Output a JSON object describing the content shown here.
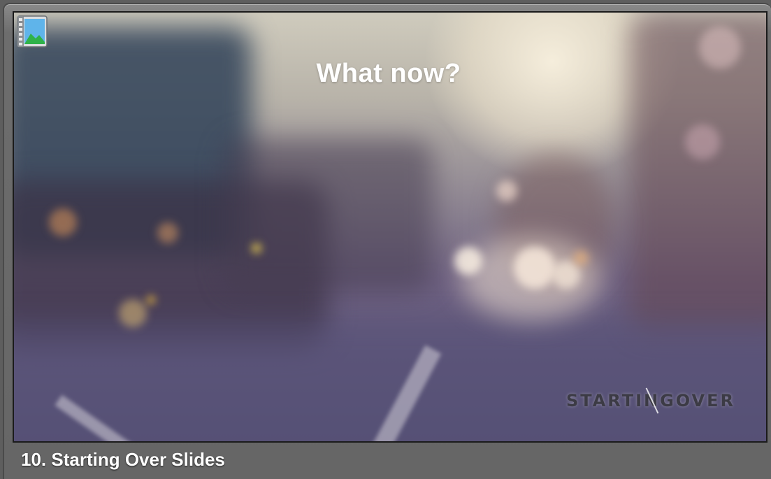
{
  "slide": {
    "headline": "What now?",
    "logo_text": "STARTINGOVER",
    "background_image": "blurred city street at dusk"
  },
  "caption": "10. Starting Over Slides",
  "icons": {
    "media_type": "image-media-icon"
  },
  "colors": {
    "frame": "#666666",
    "border": "#1b1b1b",
    "headline": "#ffffff",
    "logo": "#3c3b45"
  }
}
